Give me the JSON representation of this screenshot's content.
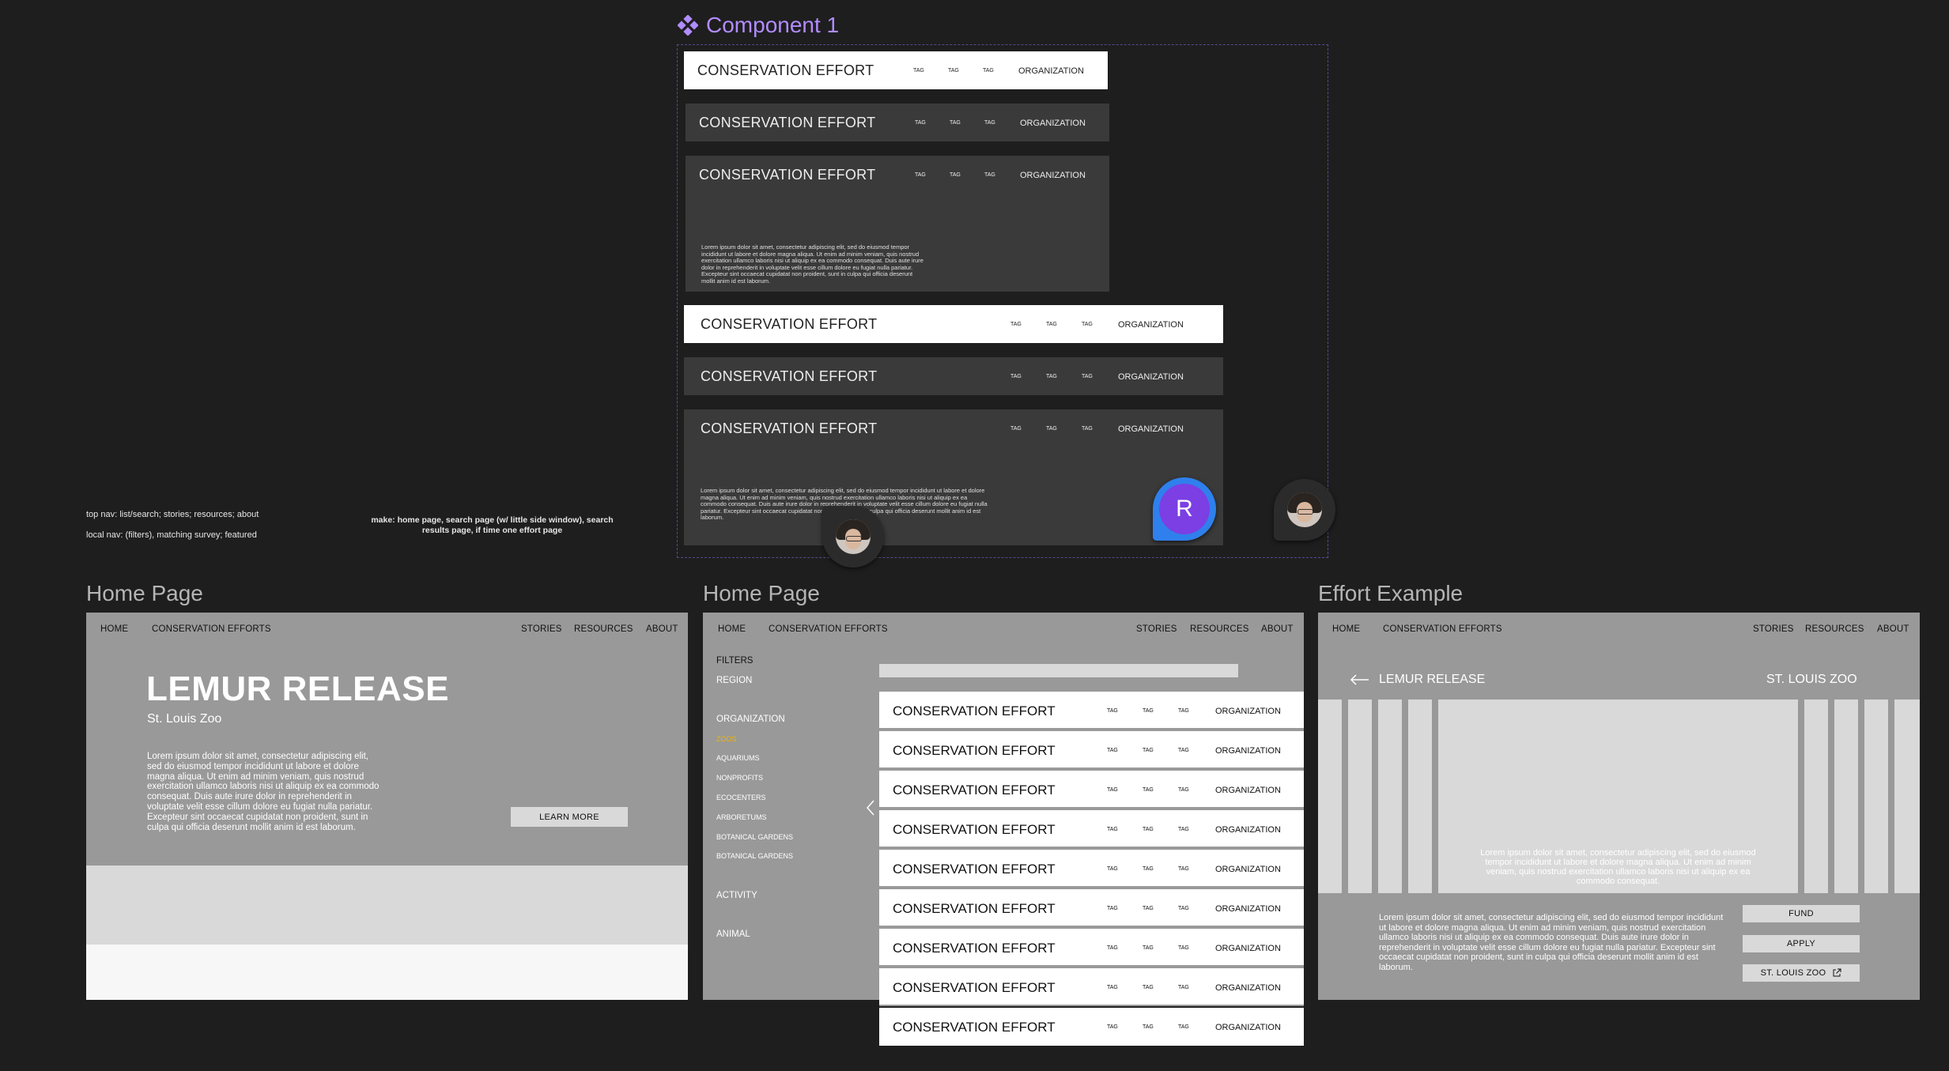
{
  "component": {
    "title": "Component 1",
    "cards": [
      {
        "title": "CONSERVATION EFFORT",
        "tags": [
          "TAG",
          "TAG",
          "TAG"
        ],
        "org": "ORGANIZATION"
      },
      {
        "title": "CONSERVATION EFFORT",
        "tags": [
          "TAG",
          "TAG",
          "TAG"
        ],
        "org": "ORGANIZATION"
      },
      {
        "title": "CONSERVATION EFFORT",
        "tags": [
          "TAG",
          "TAG",
          "TAG"
        ],
        "org": "ORGANIZATION",
        "body": "Lorem ipsum dolor sit amet, consectetur adipiscing elit, sed do eiusmod tempor incididunt ut labore et dolore magna aliqua. Ut enim ad minim veniam, quis nostrud exercitation ullamco laboris nisi ut aliquip ex ea commodo consequat. Duis aute irure dolor in reprehenderit in voluptate velit esse cillum dolore eu fugiat nulla pariatur. Excepteur sint occaecat cupidatat non proident, sunt in culpa qui officia deserunt mollit anim id est laborum."
      },
      {
        "title": "CONSERVATION EFFORT",
        "tags": [
          "TAG",
          "TAG",
          "TAG"
        ],
        "org": "ORGANIZATION"
      },
      {
        "title": "CONSERVATION EFFORT",
        "tags": [
          "TAG",
          "TAG",
          "TAG"
        ],
        "org": "ORGANIZATION"
      },
      {
        "title": "CONSERVATION EFFORT",
        "tags": [
          "TAG",
          "TAG",
          "TAG"
        ],
        "org": "ORGANIZATION",
        "body": "Lorem ipsum dolor sit amet, consectetur adipiscing elit, sed do eiusmod tempor incididunt ut labore et dolore magna aliqua. Ut enim ad minim veniam, quis nostrud exercitation ullamco laboris nisi ut aliquip ex ea commodo consequat. Duis aute irure dolor in reprehenderit in voluptate velit esse cillum dolore eu fugiat nulla pariatur. Excepteur sint occaecat cupidatat non proident, sunt in culpa qui officia deserunt mollit anim id est laborum."
      }
    ]
  },
  "notes": {
    "nav_top": "top nav: list/search; stories; resources; about",
    "nav_local": "local nav: (filters), matching survey; featured",
    "make": "make: home page, search page (w/ little side window), search results page, if time one effort page"
  },
  "collaborator": {
    "initial": "R",
    "color": "#7b3fe4",
    "ring": "#2f80ed"
  },
  "nav": {
    "home": "HOME",
    "efforts": "CONSERVATION EFFORTS",
    "stories": "STORIES",
    "resources": "RESOURCES",
    "about": "ABOUT"
  },
  "home1": {
    "label": "Home Page",
    "hero_title": "LEMUR RELEASE",
    "hero_sub": "St. Louis Zoo",
    "hero_text": "Lorem ipsum dolor sit amet, consectetur adipiscing elit, sed do eiusmod tempor incididunt ut labore et dolore magna aliqua. Ut enim ad minim veniam, quis nostrud exercitation ullamco laboris nisi ut aliquip ex ea commodo consequat. Duis aute irure dolor in reprehenderit in voluptate velit esse cillum dolore eu fugiat nulla pariatur. Excepteur sint occaecat cupidatat non proident, sunt in culpa qui officia deserunt mollit anim id est laborum.",
    "learn_more": "LEARN MORE"
  },
  "home2": {
    "label": "Home Page",
    "filters": "FILTERS",
    "region": "REGION",
    "organization": "ORGANIZATION",
    "org_items": [
      "ZOOS",
      "AQUARIUMS",
      "NONPROFITS",
      "ECOCENTERS",
      "ARBORETUMS",
      "BOTANICAL GARDENS",
      "BOTANICAL GARDENS"
    ],
    "activity": "ACTIVITY",
    "animal": "ANIMAL",
    "rows": [
      {
        "title": "CONSERVATION EFFORT",
        "tags": [
          "TAG",
          "TAG",
          "TAG"
        ],
        "org": "ORGANIZATION"
      },
      {
        "title": "CONSERVATION EFFORT",
        "tags": [
          "TAG",
          "TAG",
          "TAG"
        ],
        "org": "ORGANIZATION"
      },
      {
        "title": "CONSERVATION EFFORT",
        "tags": [
          "TAG",
          "TAG",
          "TAG"
        ],
        "org": "ORGANIZATION"
      },
      {
        "title": "CONSERVATION EFFORT",
        "tags": [
          "TAG",
          "TAG",
          "TAG"
        ],
        "org": "ORGANIZATION"
      },
      {
        "title": "CONSERVATION EFFORT",
        "tags": [
          "TAG",
          "TAG",
          "TAG"
        ],
        "org": "ORGANIZATION"
      },
      {
        "title": "CONSERVATION EFFORT",
        "tags": [
          "TAG",
          "TAG",
          "TAG"
        ],
        "org": "ORGANIZATION"
      },
      {
        "title": "CONSERVATION EFFORT",
        "tags": [
          "TAG",
          "TAG",
          "TAG"
        ],
        "org": "ORGANIZATION"
      },
      {
        "title": "CONSERVATION EFFORT",
        "tags": [
          "TAG",
          "TAG",
          "TAG"
        ],
        "org": "ORGANIZATION"
      },
      {
        "title": "CONSERVATION EFFORT",
        "tags": [
          "TAG",
          "TAG",
          "TAG"
        ],
        "org": "ORGANIZATION"
      }
    ]
  },
  "effort": {
    "label": "Effort Example",
    "title": "LEMUR RELEASE",
    "org": "ST. LOUIS ZOO",
    "overlay_text": "Lorem ipsum dolor sit amet, consectetur adipiscing elit, sed do eiusmod tempor incididunt ut labore et dolore magna aliqua. Ut enim ad minim veniam, quis nostrud exercitation ullamco laboris nisi ut aliquip ex ea commodo consequat.",
    "body": "Lorem ipsum dolor sit amet, consectetur adipiscing elit, sed do eiusmod tempor incididunt ut labore et dolore magna aliqua. Ut enim ad minim veniam, quis nostrud exercitation ullamco laboris nisi ut aliquip ex ea commodo consequat. Duis aute irure dolor in reprehenderit in voluptate velit esse cillum dolore eu fugiat nulla pariatur. Excepteur sint occaecat cupidatat non proident, sunt in culpa qui officia deserunt mollit anim id est laborum.",
    "fund": "FUND",
    "apply": "APPLY",
    "zoo_button": "ST. LOUIS ZOO"
  }
}
